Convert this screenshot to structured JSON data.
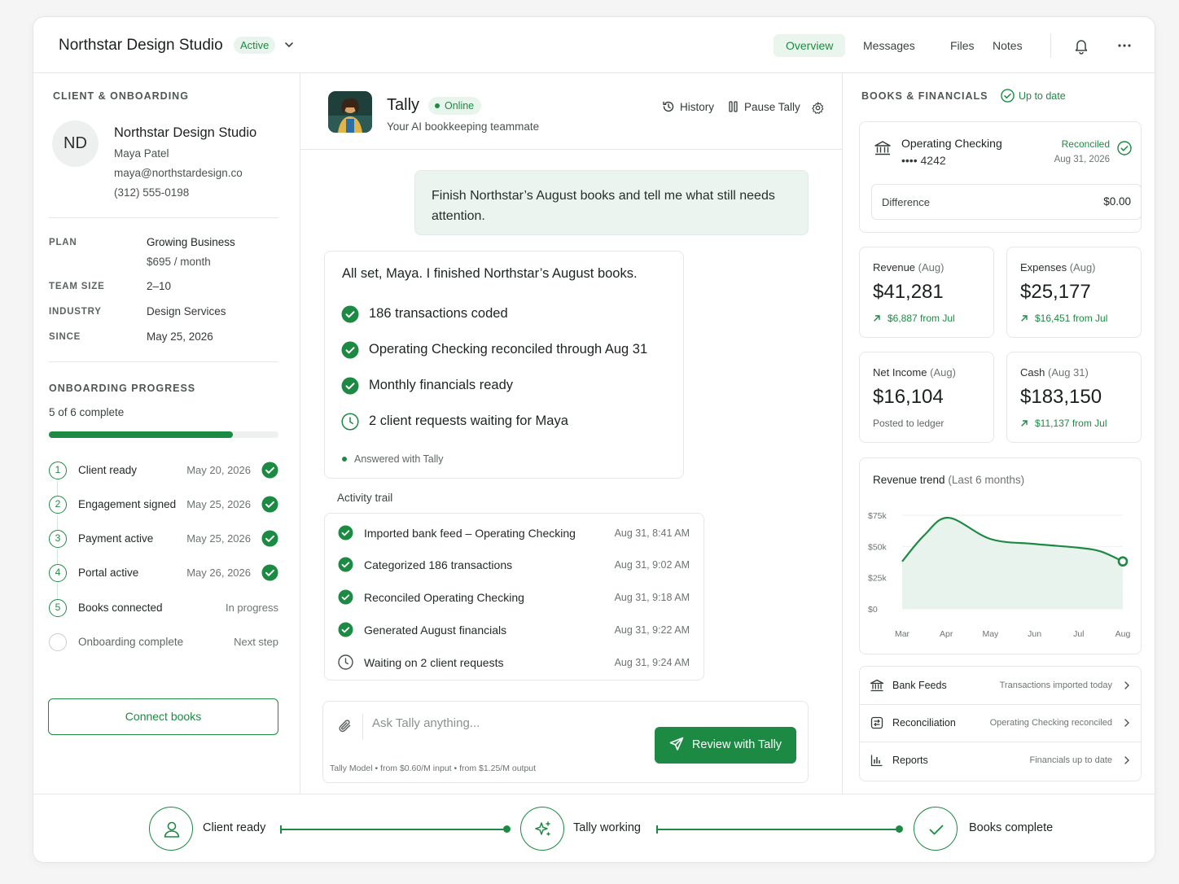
{
  "header": {
    "title": "Northstar Design Studio",
    "status": "Active",
    "nav": [
      "Overview",
      "Messages",
      "Files",
      "Notes"
    ]
  },
  "left": {
    "section_title": "CLIENT & ONBOARDING",
    "avatar_initials": "ND",
    "client_name": "Northstar Design Studio",
    "contact_name": "Maya Patel",
    "email": "maya@northstardesign.co",
    "phone": "(312) 555-0198",
    "details": {
      "plan_label": "PLAN",
      "plan_value": "Growing Business",
      "plan_price": "$695 / month",
      "team_label": "TEAM SIZE",
      "team_value": "2–10",
      "industry_label": "INDUSTRY",
      "industry_value": "Design Services",
      "since_label": "SINCE",
      "since_value": "May 25, 2026"
    },
    "progress_title": "ONBOARDING PROGRESS",
    "progress_text": "5 of 6 complete",
    "progress_fraction": 0.8,
    "steps": [
      {
        "num": "1",
        "label": "Client ready",
        "date": "May 20, 2026"
      },
      {
        "num": "2",
        "label": "Engagement signed",
        "date": "May 25, 2026"
      },
      {
        "num": "3",
        "label": "Payment active",
        "date": "May 25, 2026"
      },
      {
        "num": "4",
        "label": "Portal active",
        "date": "May 26, 2026"
      },
      {
        "num": "5",
        "label": "Books connected",
        "date": "In progress"
      },
      {
        "num": "",
        "label": "Onboarding complete",
        "date": "Next step"
      }
    ],
    "connect_button": "Connect books"
  },
  "chat": {
    "agent_name": "Tally",
    "agent_status": "Online",
    "agent_subtitle": "Your AI bookkeeping teammate",
    "actions": {
      "history": "History",
      "pause": "Pause Tally"
    },
    "user_message": "Finish Northstar’s August books and tell me what still needs attention.",
    "answer": {
      "title": "All set, Maya. I finished Northstar’s August books.",
      "items": [
        "186 transactions coded",
        "Operating Checking reconciled through Aug 31",
        "Monthly financials ready",
        "2 client requests waiting for Maya"
      ],
      "footer": "Answered with Tally"
    },
    "trail_label": "Activity trail",
    "trail": [
      {
        "text": "Imported bank feed – Operating Checking",
        "time": "Aug 31, 8:41 AM"
      },
      {
        "text": "Categorized 186 transactions",
        "time": "Aug 31, 9:02 AM"
      },
      {
        "text": "Reconciled Operating Checking",
        "time": "Aug 31, 9:18 AM"
      },
      {
        "text": "Generated August financials",
        "time": "Aug 31, 9:22 AM"
      },
      {
        "text": "Waiting on 2 client requests",
        "time": "Aug 31, 9:24 AM"
      }
    ],
    "input_placeholder": "Ask Tally anything...",
    "model_line": "Tally Model  •  from $0.60/M input  •  from $1.25/M output",
    "review_button": "Review with Tally"
  },
  "right": {
    "section_title": "BOOKS & FINANCIALS",
    "status": "Up to date",
    "account": {
      "name": "Operating Checking",
      "number": "•••• 4242",
      "status": "Reconciled",
      "date": "Aug 31, 2026",
      "diff_label": "Difference",
      "diff_value": "$0.00"
    },
    "kpis": [
      {
        "label": "Revenue",
        "period": "(Aug)",
        "value": "$41,281",
        "delta": "$6,887 from Jul"
      },
      {
        "label": "Expenses",
        "period": "(Aug)",
        "value": "$25,177",
        "delta": "$16,451 from Jul"
      },
      {
        "label": "Net Income",
        "period": "(Aug)",
        "value": "$16,104",
        "delta": "Posted to ledger"
      },
      {
        "label": "Cash",
        "period": "(Aug 31)",
        "value": "$183,150",
        "delta": "$11,137 from Jul"
      }
    ],
    "links": [
      {
        "name": "Bank Feeds",
        "status": "Transactions imported today"
      },
      {
        "name": "Reconciliation",
        "status": "Operating Checking reconciled"
      },
      {
        "name": "Reports",
        "status": "Financials up to date"
      }
    ]
  },
  "chart_data": {
    "type": "area",
    "title": "Revenue trend",
    "subtitle": "(Last 6 months)",
    "x": [
      "Mar",
      "Apr",
      "May",
      "Jun",
      "Jul",
      "Aug"
    ],
    "y_ticks": [
      "$75k",
      "$50k",
      "$25k",
      "$0"
    ],
    "ylim": [
      0,
      75
    ],
    "points": [
      {
        "x": 0,
        "y": 38
      },
      {
        "x": 0.5,
        "y": 59
      },
      {
        "x": 1.05,
        "y": 73
      },
      {
        "x": 2,
        "y": 56
      },
      {
        "x": 3,
        "y": 52
      },
      {
        "x": 4,
        "y": 49
      },
      {
        "x": 4.5,
        "y": 46
      },
      {
        "x": 5,
        "y": 38
      }
    ],
    "series_color": "#1d8a43",
    "fill_color": "#e9f3ed",
    "grid": true
  },
  "footer": {
    "steps": [
      "Client ready",
      "Tally working",
      "Books complete"
    ]
  }
}
